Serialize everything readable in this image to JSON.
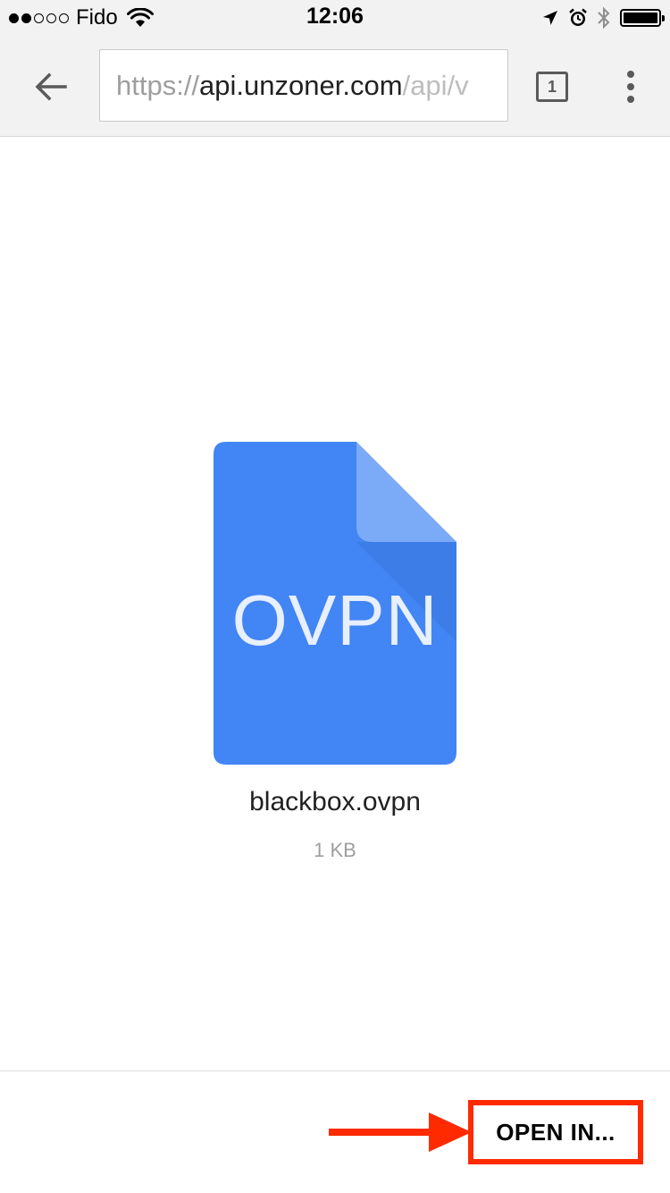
{
  "status_bar": {
    "carrier": "Fido",
    "time": "12:06",
    "signal_filled": 2,
    "signal_total": 5,
    "icons": [
      "wifi-icon",
      "location-arrow-icon",
      "alarm-icon",
      "bluetooth-icon",
      "battery-icon"
    ]
  },
  "toolbar": {
    "url_scheme": "https://",
    "url_host": "api.unzoner.com",
    "url_path": "/api/v",
    "tab_count": "1",
    "icons": [
      "back-arrow-icon",
      "tab-switcher-icon",
      "more-vert-icon"
    ]
  },
  "file": {
    "type_label": "OVPN",
    "name": "blackbox.ovpn",
    "size": "1 KB",
    "icon_color": "#4285f4",
    "fold_color": "#7baaf7"
  },
  "bottom_bar": {
    "open_in_label": "OPEN IN...",
    "highlight_color": "#ff2a00"
  }
}
